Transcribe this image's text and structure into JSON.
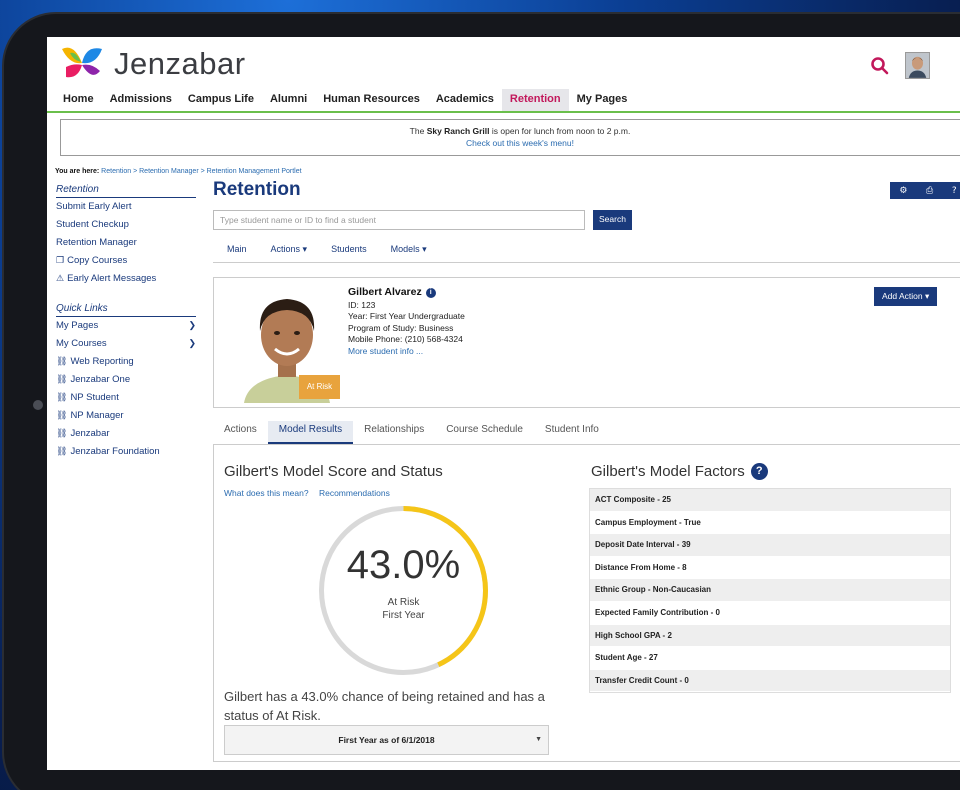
{
  "brand": {
    "name": "Jenzabar"
  },
  "nav": {
    "items": [
      "Home",
      "Admissions",
      "Campus Life",
      "Alumni",
      "Human Resources",
      "Academics",
      "Retention",
      "My Pages"
    ],
    "active": "Retention"
  },
  "announcement": {
    "prefix": "The",
    "highlight": "Sky Ranch Grill",
    "suffix": "is open for lunch from noon to 2 p.m.",
    "link": "Check out this week's menu!"
  },
  "breadcrumb": {
    "label": "You are here:",
    "path": "Retention > Retention Manager > Retention Management Portlet"
  },
  "sidebar": {
    "retention_title": "Retention",
    "retention_items": [
      "Submit Early Alert",
      "Student Checkup",
      "Retention Manager",
      "Copy Courses",
      "Early Alert Messages"
    ],
    "quick_title": "Quick Links",
    "quick_items": [
      "My Pages",
      "My Courses",
      "Web Reporting",
      "Jenzabar One",
      "NP Student",
      "NP Manager",
      "Jenzabar",
      "Jenzabar Foundation"
    ]
  },
  "page": {
    "title": "Retention"
  },
  "search": {
    "placeholder": "Type student name or ID to find a student",
    "button": "Search"
  },
  "subnav": {
    "main": "Main",
    "actions": "Actions ▾",
    "students": "Students",
    "models": "Models ▾"
  },
  "student": {
    "name": "Gilbert Alvarez",
    "id": "ID: 123",
    "year": "Year: First Year Undergraduate",
    "program": "Program of Study: Business",
    "phone": "Mobile Phone: (210) 568-4324",
    "more": "More student info ...",
    "badge": "At Risk",
    "add_action": "Add Action ▾"
  },
  "tabs": [
    "Actions",
    "Model Results",
    "Relationships",
    "Course Schedule",
    "Student Info"
  ],
  "model": {
    "score_title": "Gilbert's Model Score and Status",
    "link_meaning": "What does this mean?",
    "link_recs": "Recommendations",
    "score": "43.0%",
    "score_fraction": 0.43,
    "status": "At Risk",
    "year": "First Year",
    "summary": "Gilbert has a 43.0% chance of being retained and has a status of At Risk.",
    "select_value": "First Year as of 6/1/2018",
    "factors_title": "Gilbert's Model Factors",
    "factors": [
      "ACT Composite - 25",
      "Campus Employment - True",
      "Deposit Date Interval - 39",
      "Distance From Home - 8",
      "Ethnic Group - Non-Caucasian",
      "Expected Family Contribution - 0",
      "High School GPA - 2",
      "Student Age - 27",
      "Transfer Credit Count - 0"
    ]
  },
  "colors": {
    "brand_navy": "#1a3a7c",
    "gauge_fill": "#f5c518",
    "gauge_track": "#d9d9d9",
    "badge": "#e8a33d",
    "active_nav": "#c2185b"
  }
}
